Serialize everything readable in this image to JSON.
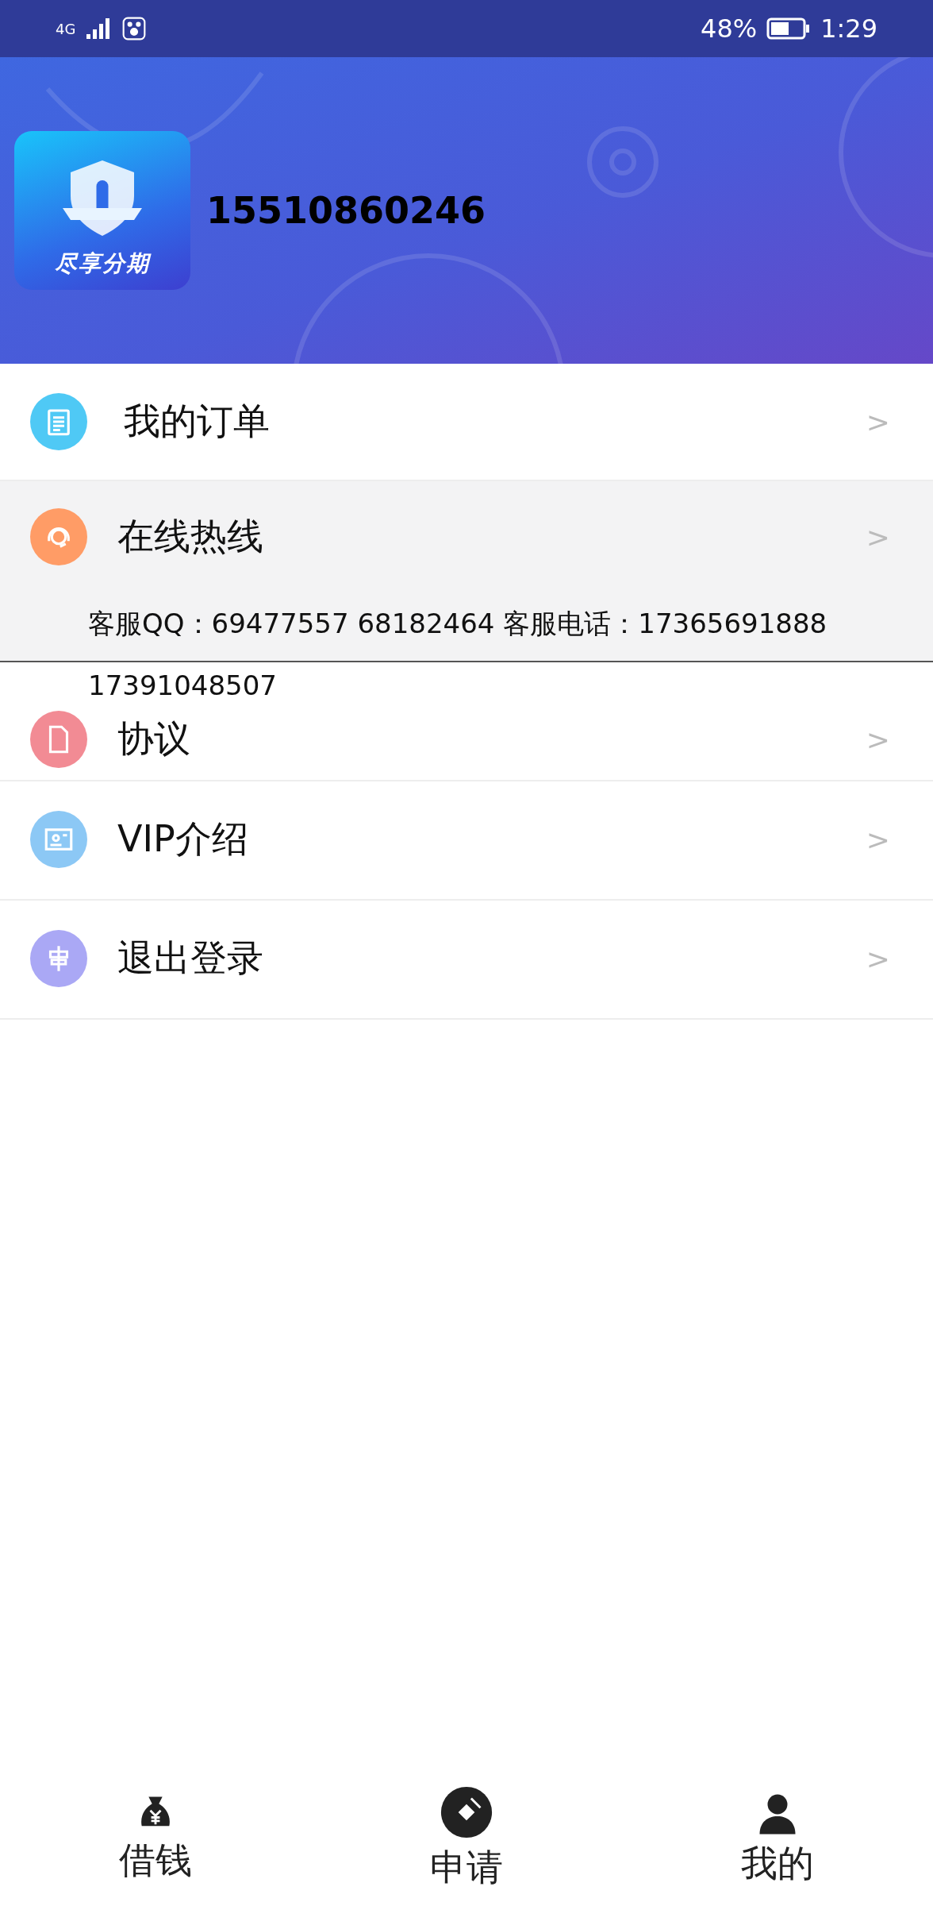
{
  "status_bar": {
    "network": "4G",
    "battery_percent": "48%",
    "time": "1:29"
  },
  "profile": {
    "logo_text": "尽享分期",
    "phone": "15510860246"
  },
  "menu": [
    {
      "label": "我的订单",
      "arrow": ">"
    },
    {
      "label": "在线热线",
      "arrow": ">",
      "detail": "客服QQ：69477557 68182464 客服电话：17365691888 17391048507"
    },
    {
      "label": "协议",
      "arrow": ">"
    },
    {
      "label": "VIP介绍",
      "arrow": ">"
    },
    {
      "label": "退出登录",
      "arrow": ">"
    }
  ],
  "tab_bar": [
    {
      "label": "借钱"
    },
    {
      "label": "申请"
    },
    {
      "label": "我的"
    }
  ]
}
